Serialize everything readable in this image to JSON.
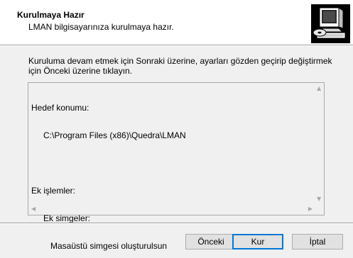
{
  "header": {
    "title": "Kurulmaya Hazır",
    "subtitle": "LMAN bilgisayarınıza kurulmaya hazır.",
    "logo_icon": "computer-install-icon"
  },
  "intro_text": "Kuruluma devam etmek için Sonraki üzerine, ayarları gözden geçirip değiştirmek için Önceki üzerine tıklayın.",
  "memo": {
    "dest_label": "Hedef konumu:",
    "dest_value": "C:\\Program Files (x86)\\Quedra\\LMAN",
    "tasks_label": "Ek işlemler:",
    "icons_label": "Ek simgeler:",
    "desktop_icon": "Masaüstü simgesi oluşturulsun"
  },
  "buttons": {
    "back": "Önceki",
    "next": "Kur",
    "cancel": "İptal"
  },
  "colors": {
    "default_button_border": "#0078d7",
    "background": "#f0f0f0",
    "header_background": "#ffffff"
  }
}
